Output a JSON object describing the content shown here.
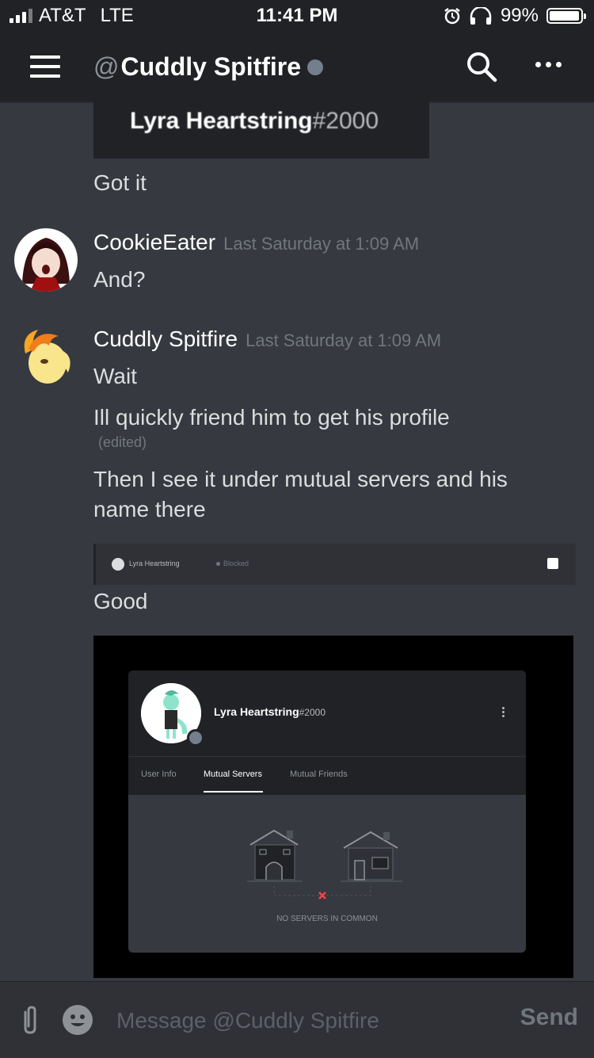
{
  "status_bar": {
    "carrier": "AT&T",
    "network": "LTE",
    "time": "11:41 PM",
    "battery_percent": "99%"
  },
  "nav": {
    "at_symbol": "@",
    "title": "Cuddly Spitfire",
    "presence": "offline"
  },
  "messages": {
    "embed_top_name": "Lyra Heartstring",
    "embed_top_tag": "#2000",
    "got_it": "Got it",
    "m2_author": "CookieEater",
    "m2_time": "Last Saturday at 1:09 AM",
    "m2_text": "And?",
    "m3_author": "Cuddly Spitfire",
    "m3_time": "Last Saturday at 1:09 AM",
    "m3_line1": "Wait",
    "m3_line2": "Ill quickly friend him to get his profile",
    "m3_edited": "(edited)",
    "m3_line3": "Then I see it under mutual servers and his name there",
    "small_embed_name": "Lyra Heartstring",
    "small_embed_status": "Blocked",
    "good": "Good"
  },
  "profile_card": {
    "name": "Lyra Heartstring",
    "tag": "#2000",
    "tabs": [
      "User Info",
      "Mutual Servers",
      "Mutual Friends"
    ],
    "active_tab": "Mutual Servers",
    "empty_text": "NO SERVERS IN COMMON"
  },
  "composer": {
    "placeholder": "Message @Cuddly Spitfire",
    "send_label": "Send"
  },
  "colors": {
    "background": "#36393f",
    "header": "#202225",
    "offline": "#747f8d",
    "error_x": "#f04747"
  }
}
